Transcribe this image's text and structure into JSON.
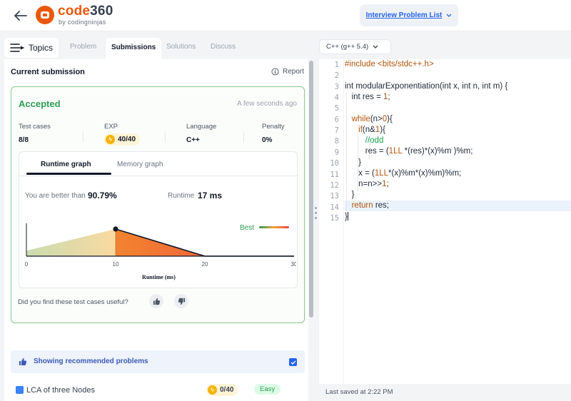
{
  "header": {
    "logo_brand": "code",
    "logo_number": "360",
    "logo_sub": "by codingninjas",
    "problem_list_label": "Interview Problem List"
  },
  "tabs": {
    "topics_label": "Topics",
    "items": [
      "Problem",
      "Submissions",
      "Solutions",
      "Discuss"
    ],
    "active": "Submissions"
  },
  "submission": {
    "heading": "Current submission",
    "report_label": "Report",
    "status": "Accepted",
    "timestamp": "A few seconds ago",
    "stats": {
      "test_cases_label": "Test cases",
      "test_cases_value": "8/8",
      "exp_label": "EXP",
      "exp_value": "40/40",
      "language_label": "Language",
      "language_value": "C++",
      "penalty_label": "Penalty",
      "penalty_value": "0%"
    },
    "graph": {
      "tabs": [
        "Runtime graph",
        "Memory graph"
      ],
      "active_tab": "Runtime graph",
      "better_text": "You are better than",
      "better_value": "90.79%",
      "runtime_text": "Runtime",
      "runtime_value": "17 ms",
      "legend_label": "Best"
    },
    "feedback_question": "Did you find these test cases useful?"
  },
  "chart_data": {
    "type": "area",
    "xlabel": "Runtime (ms)",
    "ylabel": "",
    "xlim": [
      0,
      30
    ],
    "x_ticks": [
      "0",
      "10",
      "20",
      "30"
    ],
    "x": [
      0,
      10,
      20,
      30
    ],
    "values": [
      0.2,
      1.0,
      0.0,
      0.0
    ],
    "marker_x": 10,
    "legend": "Best"
  },
  "recommended": {
    "banner_label": "Showing recommended problems",
    "checked": true,
    "items": [
      {
        "title": "LCA of three Nodes",
        "exp": "0/40",
        "difficulty": "Easy"
      }
    ]
  },
  "editor": {
    "language": "C++ (g++ 5.4)",
    "line_numbers": [
      "1",
      "2",
      "3",
      "4",
      "5",
      "6",
      "7",
      "8",
      "9",
      "10",
      "11",
      "12",
      "13",
      "14",
      "15"
    ],
    "footer": "Last saved at 2:22 PM"
  },
  "colors": {
    "brand": "#ea580c",
    "accepted": "#2e9e55",
    "link": "#2563eb"
  }
}
